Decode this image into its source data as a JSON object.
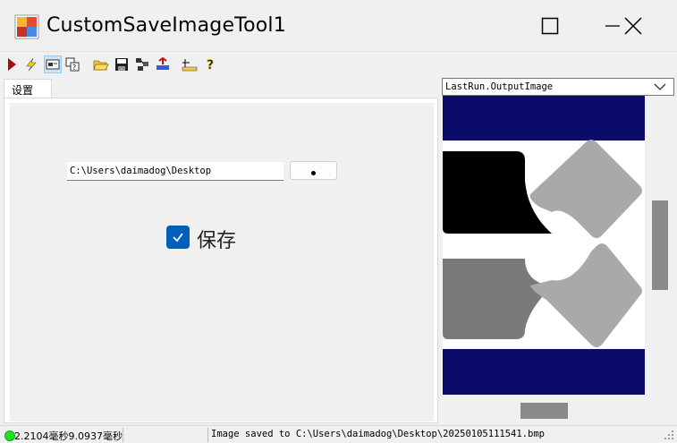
{
  "window": {
    "title": "CustomSaveImageTool1"
  },
  "toolbar": {
    "buttons": [
      "run-icon",
      "lightning-icon",
      "edit-icon",
      "graphic-icon",
      "open-folder-icon",
      "save-icon",
      "network-icon",
      "import-icon",
      "ruler-icon",
      "help-icon"
    ]
  },
  "tabs": {
    "settings_label": "设置"
  },
  "settings": {
    "path_value": "C:\\Users\\daimadog\\Desktop",
    "browse_label": "",
    "save_checkbox_label": "保存",
    "save_checked": true
  },
  "viewer": {
    "selected_image": "LastRun.OutputImage"
  },
  "statusbar": {
    "time_text": "2.2104毫秒9.0937毫秒",
    "message": "Image saved to C:\\Users\\daimadog\\Desktop\\20250105111541.bmp",
    "status_color": "#1ee31e"
  },
  "colors": {
    "accent": "#005fb8",
    "image_background": "#0b0b6a"
  }
}
